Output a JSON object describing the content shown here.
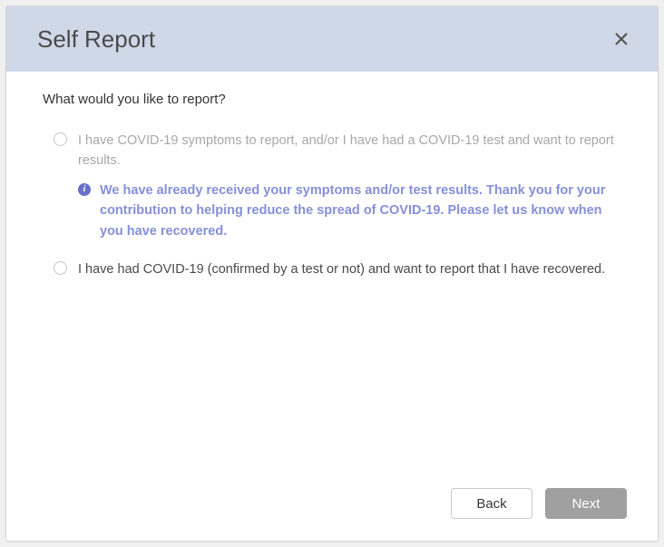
{
  "header": {
    "title": "Self Report"
  },
  "prompt": "What would you like to report?",
  "options": [
    {
      "label": "I have COVID-19 symptoms to report, and/or I have had a COVID-19 test and want to report results.",
      "disabled": true,
      "info": "We have already received your symptoms and/or test results.  Thank you for your contribution to helping reduce the spread of COVID-19. Please let us know when you have recovered."
    },
    {
      "label": "I have had COVID-19 (confirmed by a test or not) and want to report that I have recovered.",
      "disabled": false
    }
  ],
  "buttons": {
    "back": "Back",
    "next": "Next"
  },
  "colors": {
    "header_bg": "#cfd8e7",
    "info_accent": "#8690d9",
    "primary_btn_bg": "#a0a0a0"
  }
}
